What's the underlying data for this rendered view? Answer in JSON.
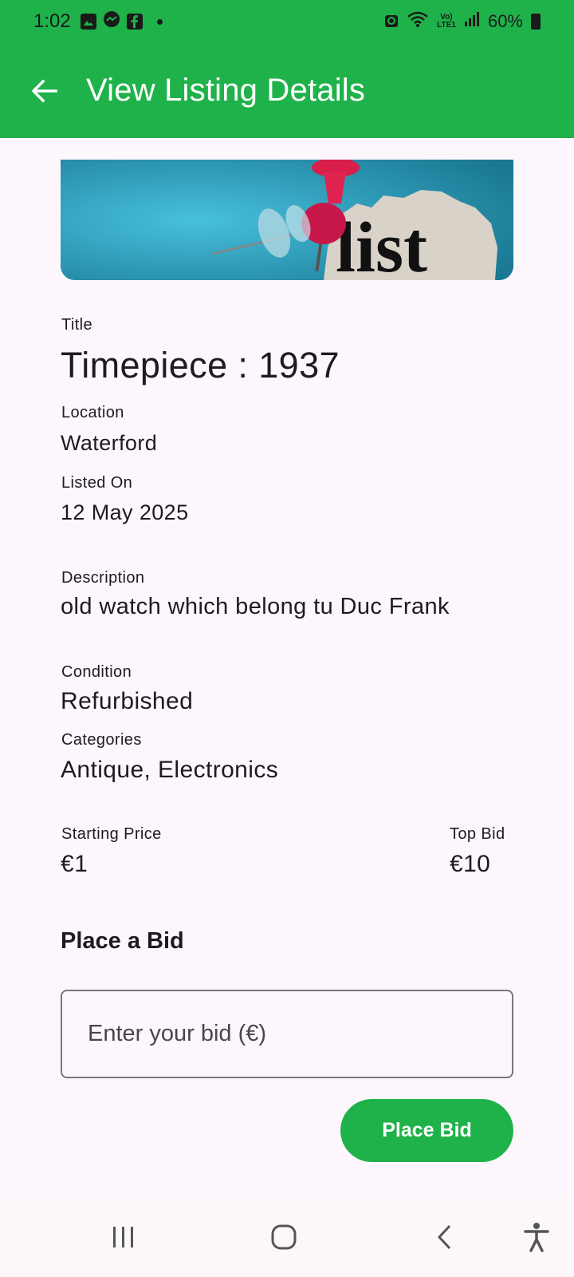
{
  "status_bar": {
    "time": "1:02",
    "network_label": "Vo) LTE1",
    "battery": "60%"
  },
  "app_bar": {
    "title": "View Listing Details"
  },
  "hero_image": {
    "caption_text": "list"
  },
  "listing": {
    "title_label": "Title",
    "title": "Timepiece : 1937",
    "location_label": "Location",
    "location": "Waterford",
    "listed_on_label": "Listed On",
    "listed_on": "12 May 2025",
    "description_label": "Description",
    "description": "old watch which belong tu Duc Frank",
    "condition_label": "Condition",
    "condition": "Refurbished",
    "categories_label": "Categories",
    "categories": "Antique, Electronics",
    "starting_price_label": "Starting Price",
    "starting_price": "€1",
    "top_bid_label": "Top Bid",
    "top_bid": "€10"
  },
  "bid": {
    "heading": "Place a Bid",
    "input_placeholder": "Enter your bid (€)",
    "input_value": "",
    "button_label": "Place Bid"
  },
  "colors": {
    "primary": "#1fb24a",
    "background": "#fdf7fd",
    "text": "#1d1b20",
    "outline": "#79747e"
  }
}
